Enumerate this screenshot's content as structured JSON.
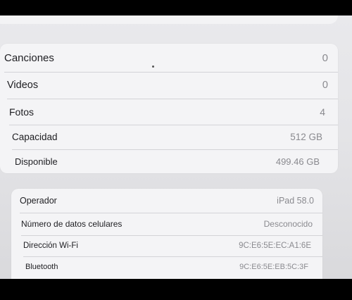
{
  "group1": {
    "rows": [
      {
        "label": "Canciones",
        "value": "0"
      },
      {
        "label": "Videos",
        "value": "0"
      },
      {
        "label": "Fotos",
        "value": "4"
      },
      {
        "label": "Capacidad",
        "value": "512 GB"
      },
      {
        "label": "Disponible",
        "value": "499.46 GB"
      }
    ]
  },
  "group2": {
    "rows": [
      {
        "label": "Operador",
        "value": "iPad 58.0"
      },
      {
        "label": "Número de datos celulares",
        "value": "Desconocido"
      },
      {
        "label": "Dirección Wi-Fi",
        "value": "9C:E6:5E:EC:A1:6E"
      },
      {
        "label": "Bluetooth",
        "value": "9C:E6:5E:EB:5C:3F"
      }
    ]
  }
}
